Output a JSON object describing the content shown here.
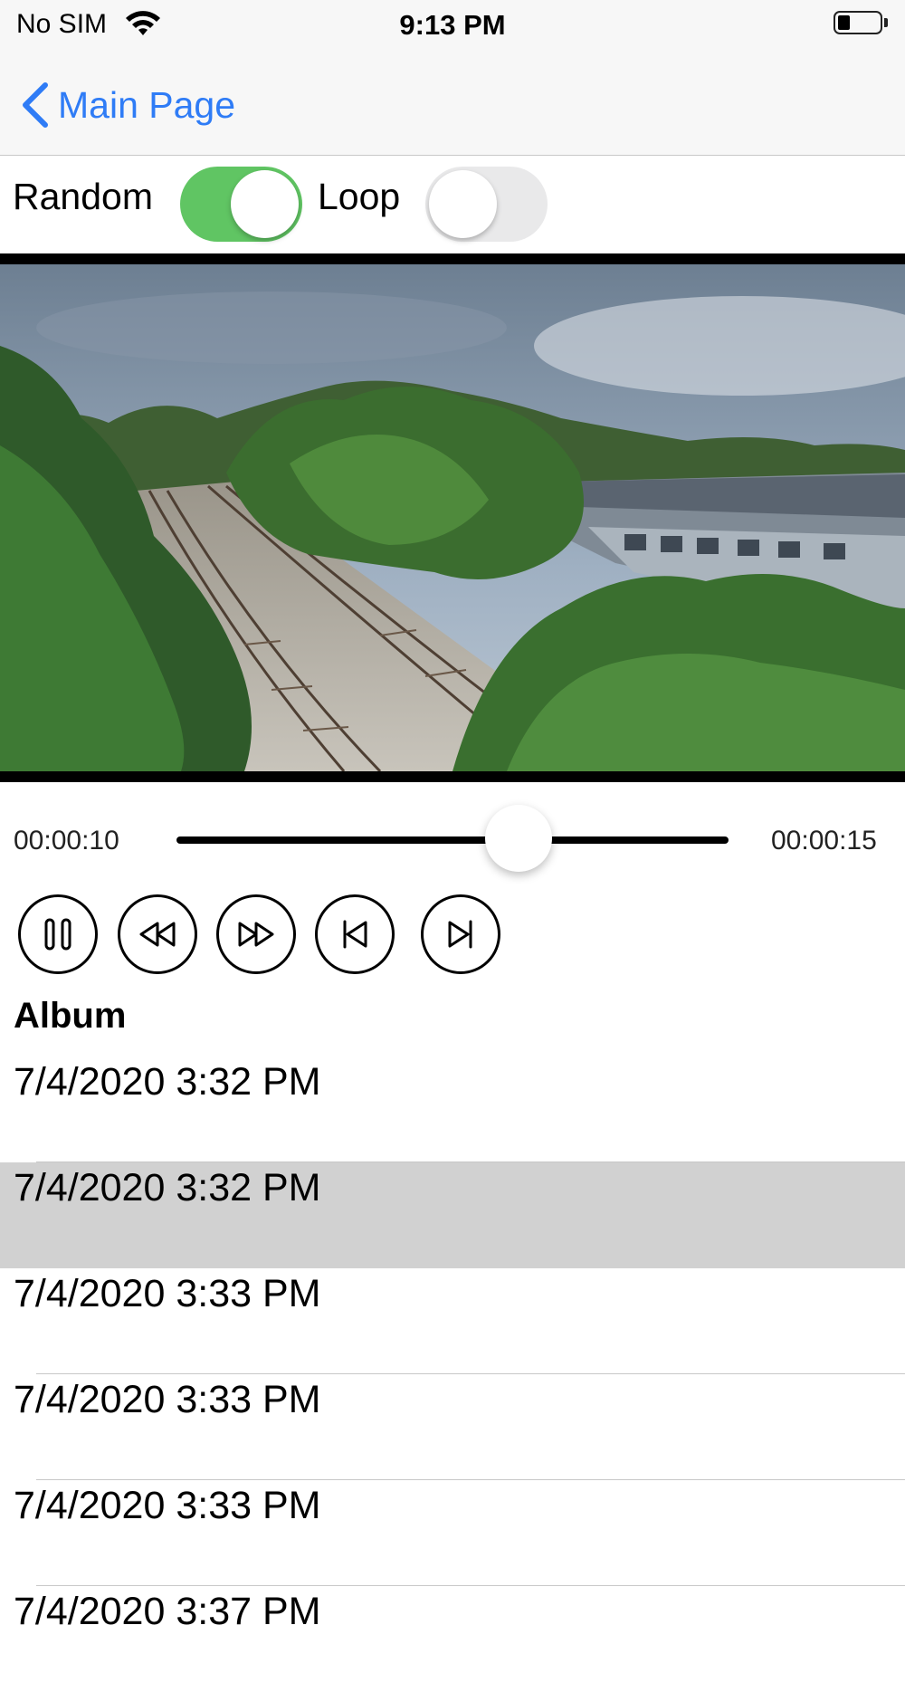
{
  "status_bar": {
    "carrier": "No SIM",
    "time": "9:13 PM",
    "wifi_icon": "wifi-icon",
    "battery_icon": "battery-low-icon"
  },
  "nav": {
    "back_label": "Main Page",
    "back_icon": "chevron-left-icon",
    "accent_color": "#2f7cf6"
  },
  "toggles": {
    "random": {
      "label": "Random",
      "on": true,
      "on_color": "#60c563"
    },
    "loop": {
      "label": "Loop",
      "on": false
    }
  },
  "player": {
    "current_time": "00:00:10",
    "total_time": "00:00:15",
    "progress": 0.62,
    "controls": [
      "pause-icon",
      "rewind-icon",
      "fast-forward-icon",
      "skip-back-icon",
      "skip-forward-icon"
    ]
  },
  "album": {
    "title": "Album",
    "selected_index": 1,
    "items": [
      "7/4/2020 3:32 PM",
      "7/4/2020 3:32 PM",
      "7/4/2020 3:33 PM",
      "7/4/2020 3:33 PM",
      "7/4/2020 3:33 PM",
      "7/4/2020 3:37 PM"
    ]
  }
}
